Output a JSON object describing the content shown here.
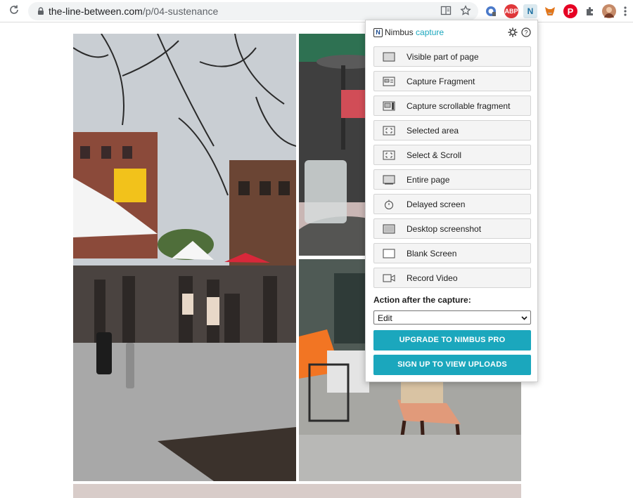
{
  "browser": {
    "url_host": "the-line-between.com",
    "url_path": "/p/04-sustenance",
    "extensions": [
      "reader-mode-icon",
      "bookmark-star-icon",
      "google-account-extension-icon",
      "adblock-plus-icon",
      "nimbus-capture-icon",
      "metamask-fox-icon",
      "pinterest-icon",
      "extensions-puzzle-icon",
      "profile-avatar",
      "more-menu-icon"
    ],
    "abp_label": "ABP",
    "nimbus_label": "N"
  },
  "popup": {
    "logo_letter": "N",
    "brand_name": "Nimbus",
    "brand_product": "capture",
    "items": [
      {
        "label": "Visible part of page",
        "icon": "visible-page-icon"
      },
      {
        "label": "Capture Fragment",
        "icon": "fragment-icon"
      },
      {
        "label": "Capture scrollable fragment",
        "icon": "scrollable-fragment-icon"
      },
      {
        "label": "Selected area",
        "icon": "selected-area-icon"
      },
      {
        "label": "Select & Scroll",
        "icon": "select-scroll-icon"
      },
      {
        "label": "Entire page",
        "icon": "entire-page-icon"
      },
      {
        "label": "Delayed screen",
        "icon": "timer-icon"
      },
      {
        "label": "Desktop screenshot",
        "icon": "desktop-icon"
      },
      {
        "label": "Blank Screen",
        "icon": "blank-screen-icon"
      },
      {
        "label": "Record Video",
        "icon": "video-camera-icon"
      }
    ],
    "action_label": "Action after the capture:",
    "action_value": "Edit",
    "upgrade_button": "UPGRADE TO NIMBUS PRO",
    "signup_button": "SIGN UP TO VIEW UPLOADS"
  },
  "colors": {
    "accent": "#1ba7bd"
  }
}
